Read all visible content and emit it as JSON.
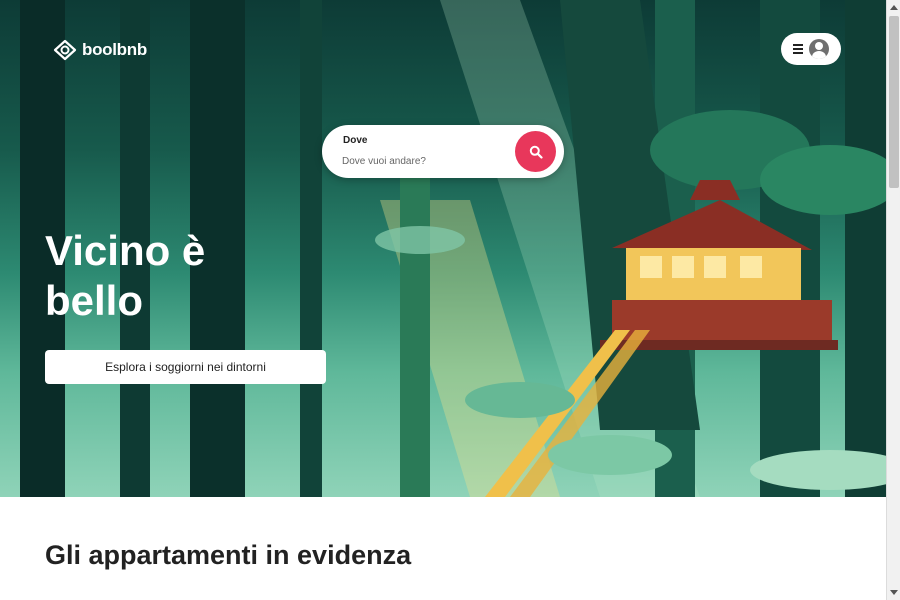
{
  "app": {
    "name": "boolbnb"
  },
  "header": {
    "menu_icon": "hamburger-icon",
    "avatar_icon": "user-avatar-icon"
  },
  "search": {
    "label": "Dove",
    "placeholder": "Dove vuoi andare?",
    "icon": "search-icon"
  },
  "hero": {
    "title": "Vicino è bello",
    "cta_label": "Esplora i soggiorni nei dintorni",
    "image": "treehouse-forest-illustration"
  },
  "featured": {
    "title": "Gli appartamenti in evidenza"
  },
  "colors": {
    "accent": "#e8375b",
    "hero_dark": "#0d3b36",
    "text": "#222222"
  }
}
